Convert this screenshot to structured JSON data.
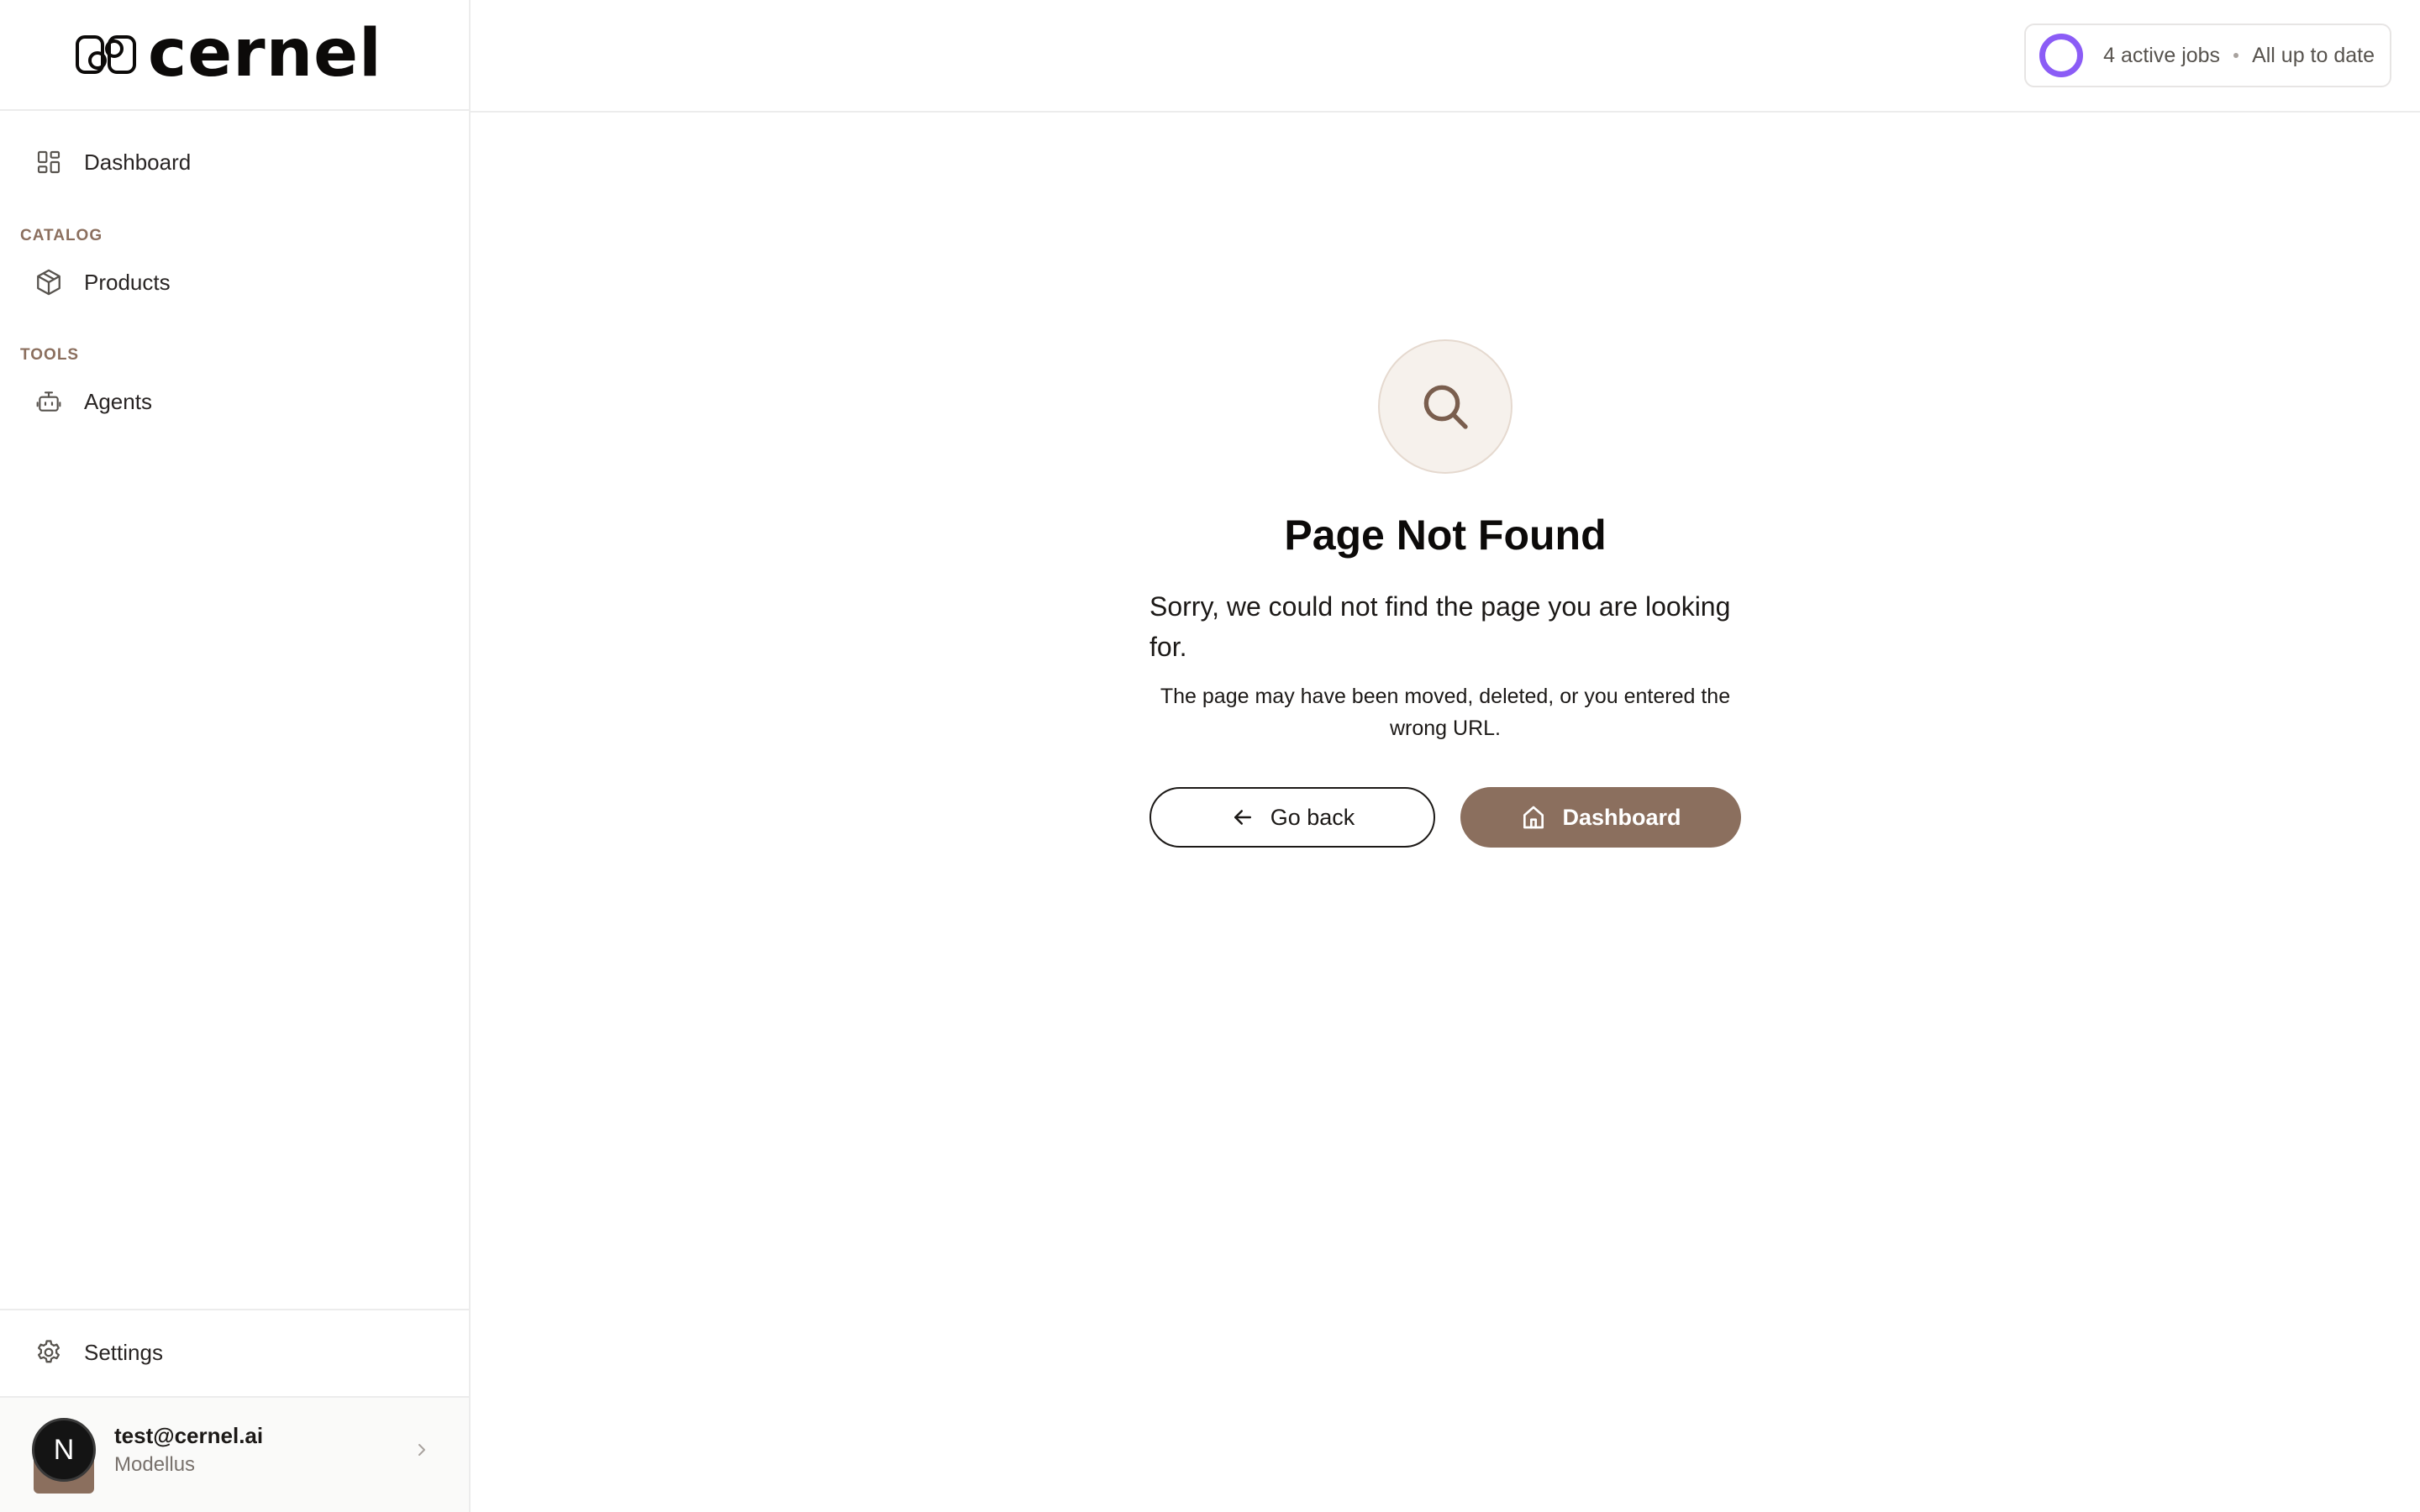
{
  "brand": {
    "name": "cernel"
  },
  "sidebar": {
    "items": [
      {
        "label": "Dashboard",
        "icon": "grid-icon"
      },
      {
        "label": "Products",
        "icon": "box-icon"
      },
      {
        "label": "Agents",
        "icon": "robot-icon"
      }
    ],
    "sections": {
      "catalog": "CATALOG",
      "tools": "TOOLS"
    },
    "settings_label": "Settings",
    "user": {
      "avatar_initial": "N",
      "email": "test@cernel.ai",
      "org": "Modellus"
    }
  },
  "header": {
    "jobs_label": "4 active jobs",
    "status_label": "All up to date",
    "ring_color": "#8b5cf6"
  },
  "main": {
    "title": "Page Not Found",
    "subtitle": "Sorry, we could not find the page you are looking for.",
    "description": "The page may have been moved, deleted, or you entered the wrong URL.",
    "back_button": "Go back",
    "dashboard_button": "Dashboard"
  },
  "colors": {
    "accent": "#8b6f5e",
    "section_label": "#8b6f5e",
    "border": "#ececec"
  }
}
